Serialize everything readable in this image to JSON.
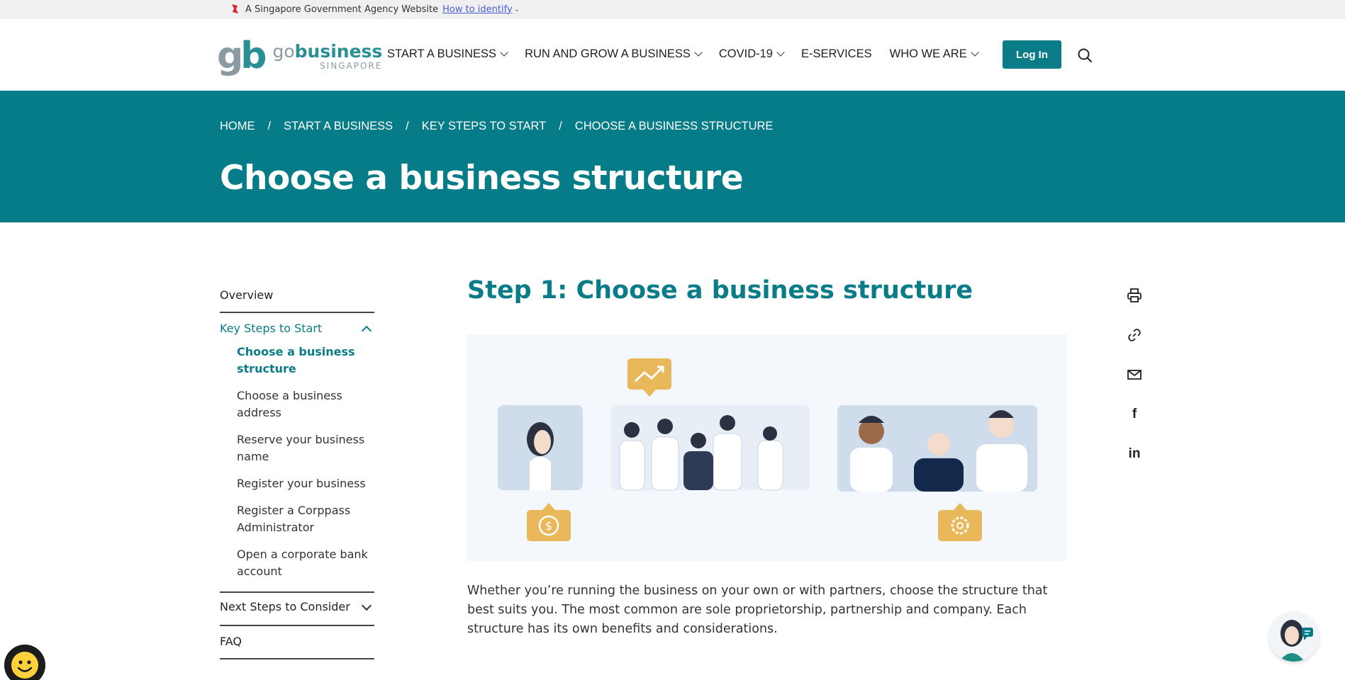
{
  "masthead": {
    "text": "A Singapore Government Agency Website",
    "link": "How to identify"
  },
  "logo": {
    "mark": "gb",
    "word_go": "go",
    "word_business": "business",
    "tagline": "SINGAPORE"
  },
  "nav": {
    "items": [
      {
        "label": "START A BUSINESS",
        "dropdown": true
      },
      {
        "label": "RUN AND GROW A BUSINESS",
        "dropdown": true
      },
      {
        "label": "COVID-19",
        "dropdown": true
      },
      {
        "label": "E-SERVICES",
        "dropdown": false
      },
      {
        "label": "WHO WE ARE",
        "dropdown": true
      }
    ],
    "login": "Log In"
  },
  "breadcrumb": [
    "HOME",
    "START A BUSINESS",
    "KEY STEPS TO START",
    "CHOOSE A BUSINESS STRUCTURE"
  ],
  "breadcrumb_sep": "/",
  "page_title": "Choose a business structure",
  "sidebar": {
    "overview": "Overview",
    "key_steps": "Key Steps to Start",
    "sub_items": [
      "Choose a business structure",
      "Choose a business address",
      "Reserve your business name",
      "Register your business",
      "Register a Corppass Administrator",
      "Open a corporate bank account"
    ],
    "next_steps": "Next Steps to Consider",
    "faq": "FAQ"
  },
  "main": {
    "heading": "Step 1: Choose a business structure",
    "paragraph": "Whether you’re running the business on your own or with partners, choose the structure that best suits you. The most common are sole proprietorship, partnership and company. Each structure has its own benefits and considerations."
  },
  "share": {
    "linkedin_label": "in",
    "facebook_label": "f"
  },
  "colors": {
    "brand": "#067c88",
    "accent_gold": "#e8b85a",
    "text": "#222222"
  }
}
